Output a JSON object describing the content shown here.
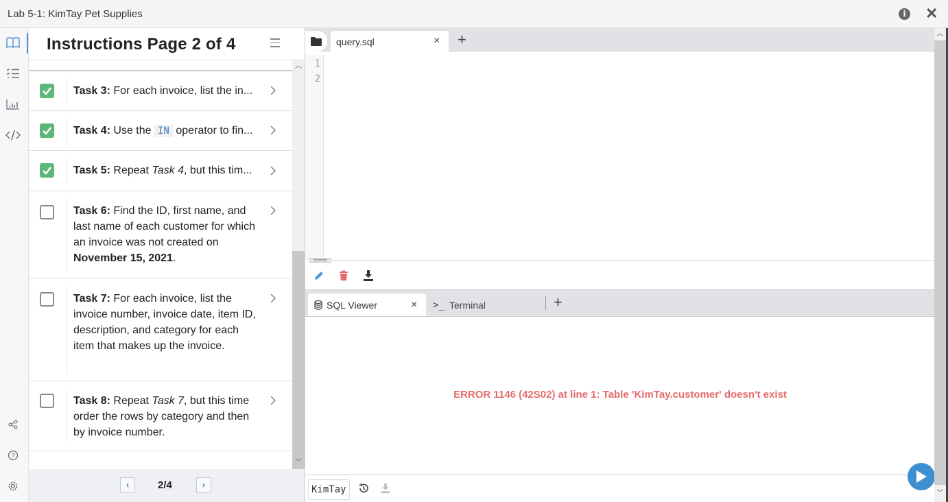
{
  "window": {
    "title": "Lab 5-1: KimTay Pet Supplies",
    "info_icon": "info-icon",
    "close_icon": "close-icon"
  },
  "icon_rail": {
    "top": [
      "book-icon",
      "checklist-icon",
      "bar-chart-icon",
      "code-icon"
    ],
    "bottom": [
      "share-icon",
      "help-icon",
      "gear-icon"
    ],
    "active": "book-icon"
  },
  "instructions": {
    "heading": "Instructions Page 2 of 4",
    "menu_icon": "hamburger-icon",
    "tasks": [
      {
        "label": "Task 3:",
        "text": "For each invoice, list the in...",
        "done": true
      },
      {
        "label": "Task 4:",
        "pre": "Use the",
        "code": "IN",
        "post": "operator to fin...",
        "done": true
      },
      {
        "label": "Task 5:",
        "pre": "Repeat",
        "em": "Task 4",
        "post": ", but this tim...",
        "done": true
      },
      {
        "label": "Task 6:",
        "pre": "Find the ID, first name, and last name of each customer for which an invoice was not created on",
        "strong": "November 15, 2021",
        "post": ".",
        "done": false
      },
      {
        "label": "Task 7:",
        "text": "For each invoice, list the invoice number, invoice date, item ID, description, and category for each item that makes up the invoice.",
        "done": false
      },
      {
        "label": "Task 8:",
        "pre": "Repeat",
        "em": "Task 7",
        "post": ", but this time order the rows by category and then by invoice number.",
        "done": false
      }
    ],
    "pagination": {
      "label": "2/4",
      "prev": "‹",
      "next": "›"
    }
  },
  "editor": {
    "tabs": [
      {
        "name": "query.sql",
        "close": "×"
      }
    ],
    "add_tab": "+",
    "line_numbers": [
      "1",
      "2"
    ],
    "tools": [
      "pencil-icon",
      "trash-icon",
      "download-icon"
    ]
  },
  "bottom_panel": {
    "tabs": [
      {
        "name": "SQL Viewer",
        "icon": "database-icon",
        "close": "×",
        "active": true
      },
      {
        "name": "Terminal",
        "icon": "terminal-icon",
        "active": false
      }
    ],
    "add_tab": "+",
    "error": "ERROR 1146 (42S02) at line 1: Table 'KimTay.customer' doesn't exist",
    "database": "KimTay"
  },
  "colors": {
    "accent": "#3d8fd0",
    "check": "#5bb878",
    "error": "#e56b6b",
    "trash": "#e56b6b"
  }
}
